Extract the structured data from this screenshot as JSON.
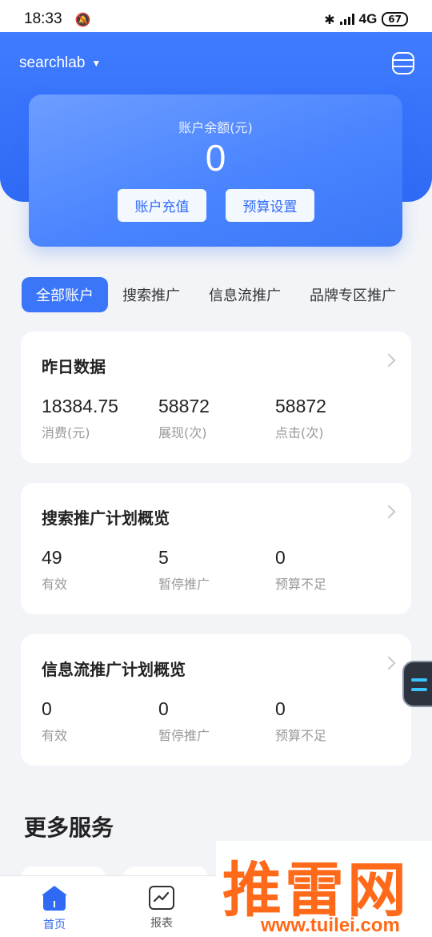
{
  "status_bar": {
    "time": "18:33",
    "network": "4G",
    "battery": "67"
  },
  "header": {
    "account_name": "searchlab",
    "balance_label": "账户余额(元)",
    "balance_value": "0",
    "recharge_button": "账户充值",
    "budget_button": "预算设置"
  },
  "tabs": [
    {
      "label": "全部账户",
      "active": true
    },
    {
      "label": "搜索推广",
      "active": false
    },
    {
      "label": "信息流推广",
      "active": false
    },
    {
      "label": "品牌专区推广",
      "active": false
    }
  ],
  "cards": {
    "yesterday": {
      "title": "昨日数据",
      "stats": [
        {
          "value": "18384.75",
          "label": "消费(元)"
        },
        {
          "value": "58872",
          "label": "展现(次)"
        },
        {
          "value": "58872",
          "label": "点击(次)"
        }
      ]
    },
    "search_plan": {
      "title": "搜索推广计划概览",
      "stats": [
        {
          "value": "49",
          "label": "有效"
        },
        {
          "value": "5",
          "label": "暂停推广"
        },
        {
          "value": "0",
          "label": "预算不足"
        }
      ]
    },
    "feed_plan": {
      "title": "信息流推广计划概览",
      "stats": [
        {
          "value": "0",
          "label": "有效"
        },
        {
          "value": "0",
          "label": "暂停推广"
        },
        {
          "value": "0",
          "label": "预算不足"
        }
      ]
    }
  },
  "more_services": {
    "title": "更多服务"
  },
  "bottom_nav": {
    "home": "首页",
    "report": "报表"
  },
  "watermark": {
    "brand": "推雷网",
    "url": "www.tuilei.com"
  },
  "colors": {
    "primary": "#2f6af5",
    "background": "#f2f4f7",
    "watermark": "#ff6a1a"
  }
}
